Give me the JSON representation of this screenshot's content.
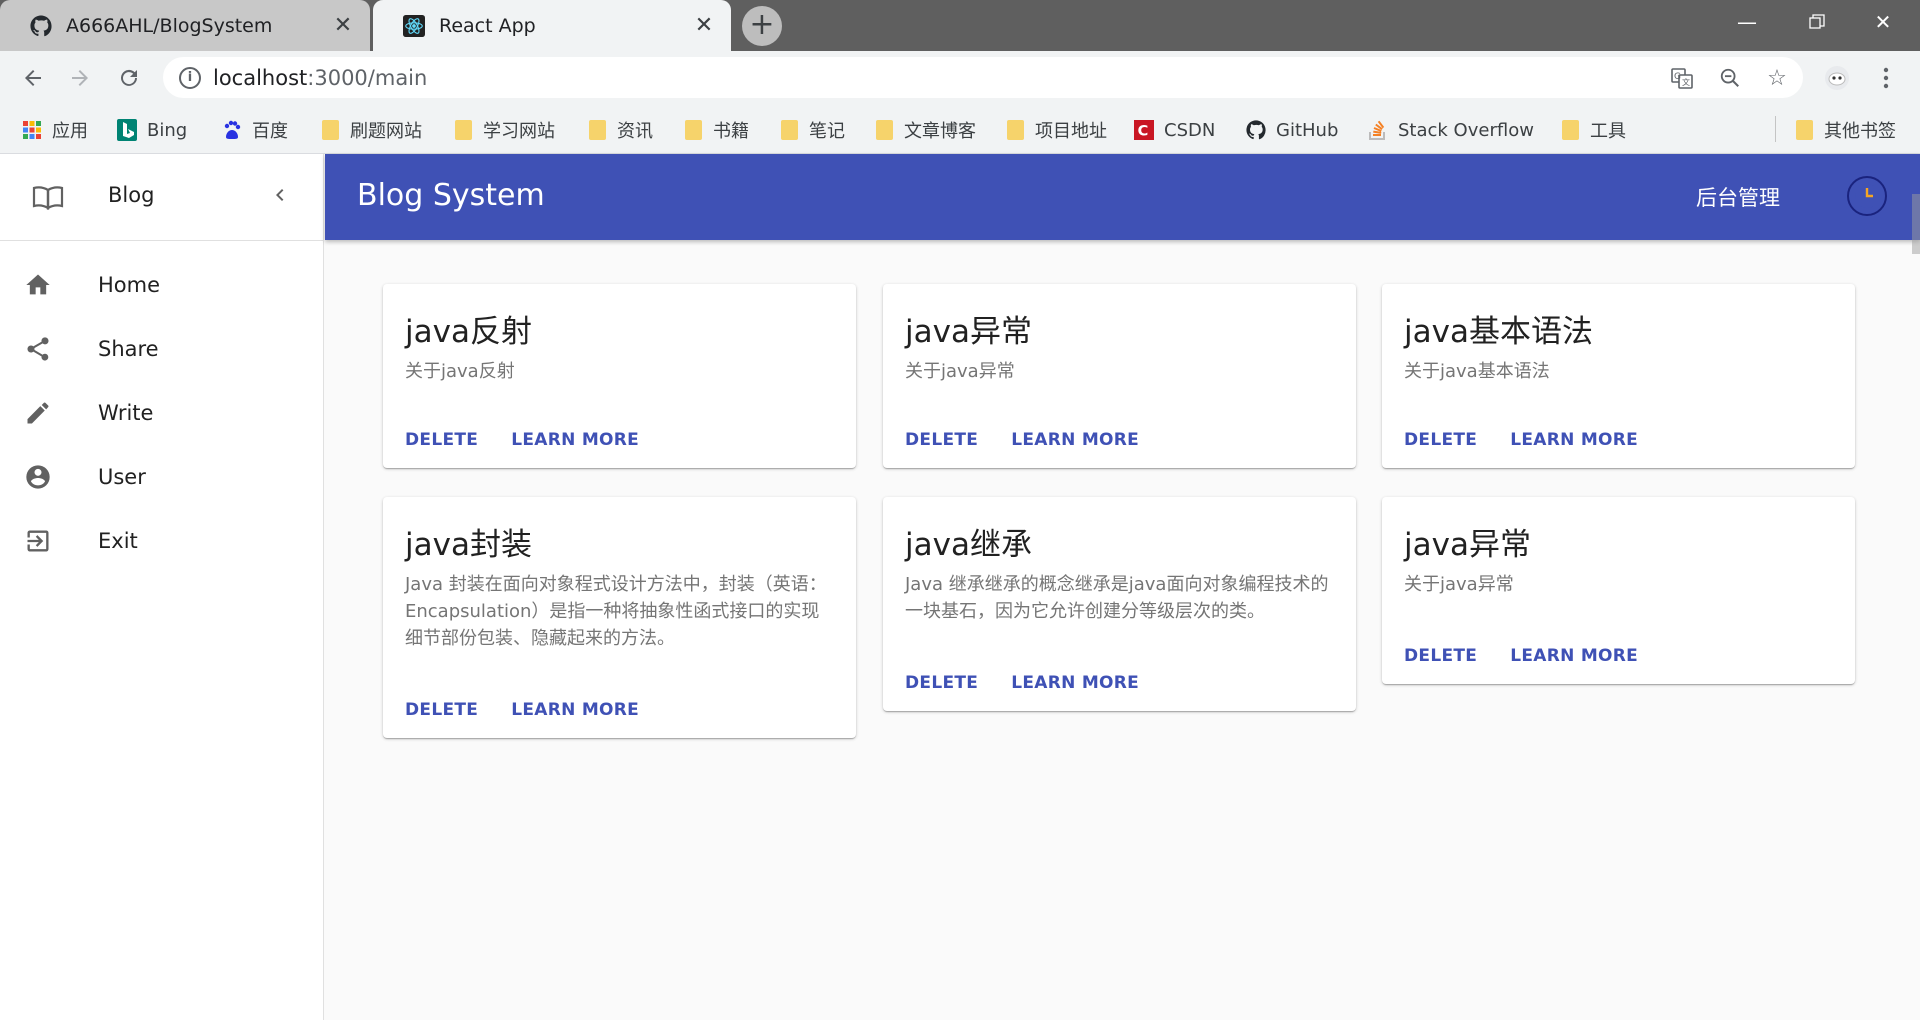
{
  "browser": {
    "tabs": [
      {
        "title": "A666AHL/BlogSystem",
        "favicon": "github-icon",
        "active": false
      },
      {
        "title": "React App",
        "favicon": "react-icon",
        "active": true
      }
    ],
    "new_tab_label": "+",
    "url_host": "localhost",
    "url_path": ":3000/main",
    "bookmarks": [
      {
        "label": "应用",
        "icon": "apps-icon"
      },
      {
        "label": "Bing",
        "icon": "bing-icon"
      },
      {
        "label": "百度",
        "icon": "baidu-icon"
      },
      {
        "label": "刷题网站",
        "icon": "folder-icon"
      },
      {
        "label": "学习网站",
        "icon": "folder-icon"
      },
      {
        "label": "资讯",
        "icon": "folder-icon"
      },
      {
        "label": "书籍",
        "icon": "folder-icon"
      },
      {
        "label": "笔记",
        "icon": "folder-icon"
      },
      {
        "label": "文章博客",
        "icon": "folder-icon"
      },
      {
        "label": "项目地址",
        "icon": "folder-icon"
      },
      {
        "label": "CSDN",
        "icon": "csdn-icon"
      },
      {
        "label": "GitHub",
        "icon": "github-icon"
      },
      {
        "label": "Stack Overflow",
        "icon": "stackoverflow-icon"
      },
      {
        "label": "工具",
        "icon": "folder-icon"
      },
      {
        "label": "其他书签",
        "icon": "folder-icon"
      }
    ]
  },
  "drawer": {
    "brand": "Blog",
    "items": [
      {
        "label": "Home",
        "icon": "home-icon"
      },
      {
        "label": "Share",
        "icon": "share-icon"
      },
      {
        "label": "Write",
        "icon": "pencil-icon"
      },
      {
        "label": "User",
        "icon": "account-icon"
      },
      {
        "label": "Exit",
        "icon": "exit-icon"
      }
    ]
  },
  "appbar": {
    "title": "Blog System",
    "admin_label": "后台管理"
  },
  "colors": {
    "primary": "#3f51b5",
    "accent_clock": "#f5a623"
  },
  "cards": [
    {
      "title": "java反射",
      "description": "关于java反射",
      "delete_label": "DELETE",
      "more_label": "LEARN MORE"
    },
    {
      "title": "java异常",
      "description": "关于java异常",
      "delete_label": "DELETE",
      "more_label": "LEARN MORE"
    },
    {
      "title": "java基本语法",
      "description": "关于java基本语法",
      "delete_label": "DELETE",
      "more_label": "LEARN MORE"
    },
    {
      "title": "java封装",
      "description": "Java 封装在面向对象程式设计方法中，封装（英语：Encapsulation）是指一种将抽象性函式接口的实现细节部份包装、隐藏起来的方法。",
      "delete_label": "DELETE",
      "more_label": "LEARN MORE"
    },
    {
      "title": "java继承",
      "description": "Java 继承继承的概念继承是java面向对象编程技术的一块基石，因为它允许创建分等级层次的类。",
      "delete_label": "DELETE",
      "more_label": "LEARN MORE"
    },
    {
      "title": "java异常",
      "description": "关于java异常",
      "delete_label": "DELETE",
      "more_label": "LEARN MORE"
    }
  ]
}
